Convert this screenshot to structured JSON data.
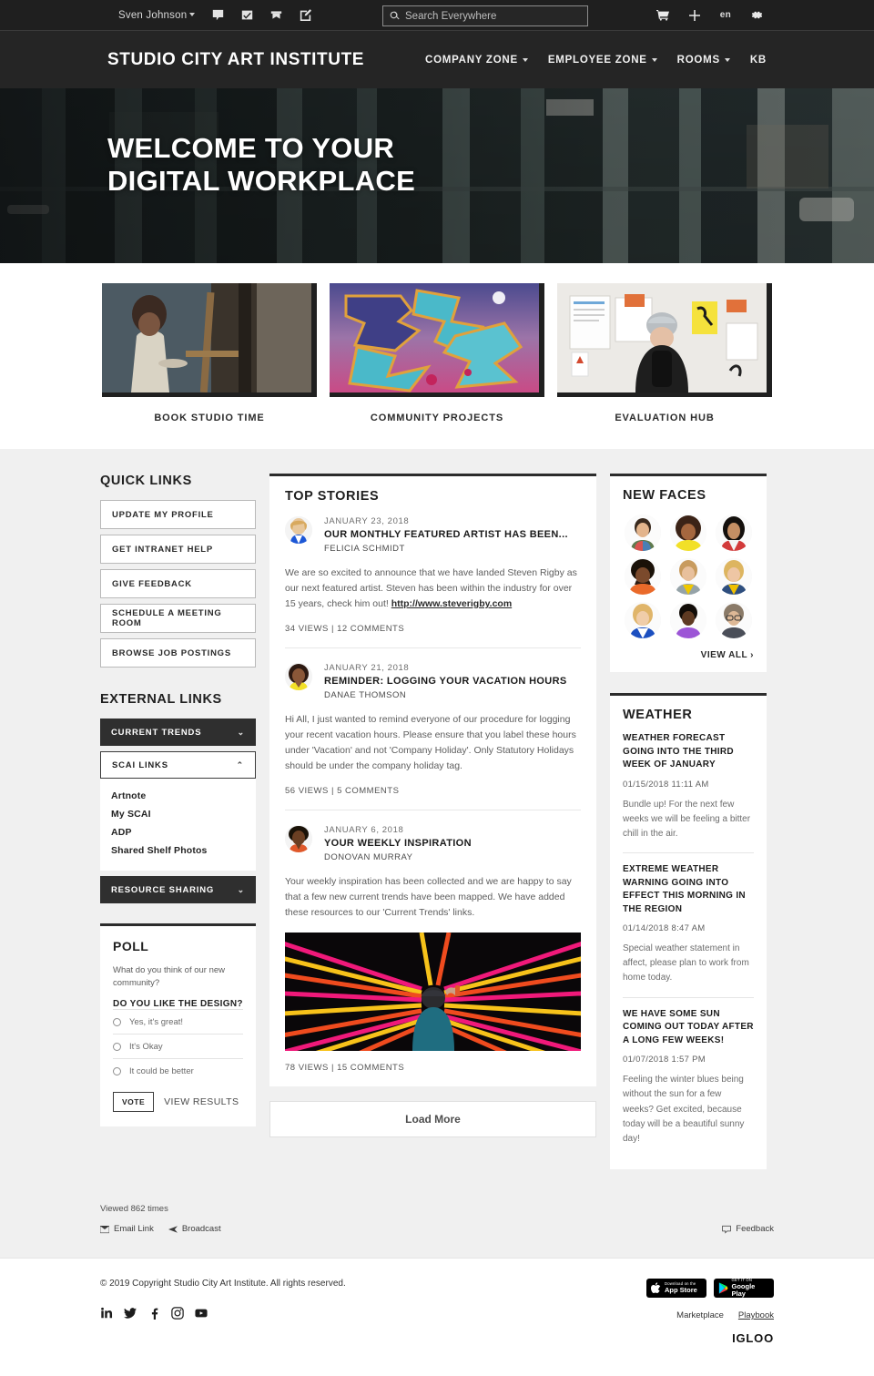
{
  "utility": {
    "user_name": "Sven Johnson",
    "icons": [
      "chat-icon",
      "tasks-icon",
      "bookmark-icon",
      "compose-icon"
    ],
    "search": {
      "placeholder": "Search Everywhere",
      "value": ""
    },
    "right_icons": [
      "cart-icon",
      "plus-icon",
      "gear-icon"
    ],
    "language": "en"
  },
  "header": {
    "brand": "STUDIO CITY ART INSTITUTE",
    "nav": [
      {
        "label": "COMPANY ZONE",
        "has_caret": true
      },
      {
        "label": "EMPLOYEE ZONE",
        "has_caret": true
      },
      {
        "label": "ROOMS",
        "has_caret": true
      },
      {
        "label": "KB",
        "has_caret": false
      }
    ]
  },
  "hero": {
    "line1": "WELCOME TO YOUR",
    "line2": "DIGITAL WORKPLACE"
  },
  "tiles": [
    {
      "label": "BOOK STUDIO TIME"
    },
    {
      "label": "COMMUNITY PROJECTS"
    },
    {
      "label": "EVALUATION HUB"
    }
  ],
  "quick_links": {
    "title": "QUICK LINKS",
    "items": [
      "UPDATE MY PROFILE",
      "GET INTRANET HELP",
      "GIVE FEEDBACK",
      "SCHEDULE A MEETING ROOM",
      "BROWSE JOB POSTINGS"
    ]
  },
  "external_links": {
    "title": "EXTERNAL LINKS",
    "groups": [
      {
        "label": "CURRENT TRENDS",
        "expanded": false,
        "chevron": "⌄",
        "items": []
      },
      {
        "label": "SCAI LINKS",
        "expanded": true,
        "chevron": "⌃",
        "items": [
          "Artnote",
          "My SCAI",
          "ADP",
          "Shared Shelf Photos"
        ]
      },
      {
        "label": "RESOURCE SHARING",
        "expanded": false,
        "chevron": "⌄",
        "items": []
      }
    ]
  },
  "poll": {
    "title": "POLL",
    "question": "What do you think of our new community?",
    "subtitle": "DO YOU LIKE THE DESIGN?",
    "options": [
      "Yes, it's great!",
      "It's Okay",
      "It could be better"
    ],
    "vote_label": "VOTE",
    "results_label": "VIEW RESULTS"
  },
  "top_stories": {
    "title": "TOP STORIES",
    "load_more": "Load More",
    "items": [
      {
        "date": "JANUARY 23, 2018",
        "title": "OUR MONTHLY FEATURED ARTIST HAS BEEN...",
        "author": "FELICIA SCHMIDT",
        "body_before": "We are so excited to announce that we have landed Steven Rigby as our next featured artist. Steven has been within the industry for over 15 years, check him out! ",
        "link": "http://www.steverigby.com",
        "meta": "34 VIEWS | 12 COMMENTS",
        "has_image": false
      },
      {
        "date": "JANUARY 21, 2018",
        "title": "REMINDER: LOGGING YOUR VACATION HOURS",
        "author": "DANAE THOMSON",
        "body_before": "Hi All, I just wanted to remind everyone of our procedure for logging your recent vacation hours. Please ensure that you label these hours under 'Vacation' and not 'Company Holiday'. Only Statutory Holidays should be under the company holiday tag.",
        "link": "",
        "meta": "56 VIEWS | 5 COMMENTS",
        "has_image": false
      },
      {
        "date": "JANUARY 6, 2018",
        "title": "YOUR WEEKLY INSPIRATION",
        "author": "DONOVAN MURRAY",
        "body_before": "Your weekly inspiration has been collected and we are happy to say that a few new current trends have been mapped. We have added these resources to our 'Current Trends' links.",
        "link": "",
        "meta": "78 VIEWS | 15 COMMENTS",
        "has_image": true
      }
    ]
  },
  "new_faces": {
    "title": "NEW FACES",
    "view_all": "VIEW ALL ›",
    "count": 9
  },
  "weather": {
    "title": "WEATHER",
    "items": [
      {
        "headline": "WEATHER FORECAST GOING INTO THE THIRD WEEK OF JANUARY",
        "time": "01/15/2018 11:11 AM",
        "body": "Bundle up! For the next few weeks we will be feeling a bitter chill in the air."
      },
      {
        "headline": "EXTREME WEATHER WARNING GOING INTO EFFECT THIS MORNING IN THE REGION",
        "time": "01/14/2018 8:47 AM",
        "body": "Special weather statement in affect, please plan to work from home today."
      },
      {
        "headline": "WE HAVE SOME SUN COMING OUT TODAY AFTER A LONG FEW WEEKS!",
        "time": "01/07/2018 1:57 PM",
        "body": "Feeling the winter blues being without the sun for a few weeks? Get excited, because today will be a beautiful sunny day!"
      }
    ]
  },
  "page_meta": {
    "viewed": "Viewed 862 times",
    "email_link": "Email Link",
    "broadcast": "Broadcast",
    "feedback": "Feedback"
  },
  "footer": {
    "copyright": "© 2019 Copyright Studio City Art Institute. All rights reserved.",
    "social": [
      "linkedin-icon",
      "twitter-icon",
      "facebook-icon",
      "instagram-icon",
      "youtube-icon"
    ],
    "app_store": {
      "small": "Download on the",
      "big": "App Store"
    },
    "google_play": {
      "small": "GET IT ON",
      "big": "Google Play"
    },
    "links": [
      "Marketplace",
      "Playbook"
    ],
    "brand": "IGLOO"
  },
  "colors": {
    "header_bg": "#252525",
    "utility_bg": "#1f1f1f",
    "body_bg": "#f0f0f0",
    "accent_dark": "#2f2f2f",
    "card_bg": "#ffffff"
  }
}
